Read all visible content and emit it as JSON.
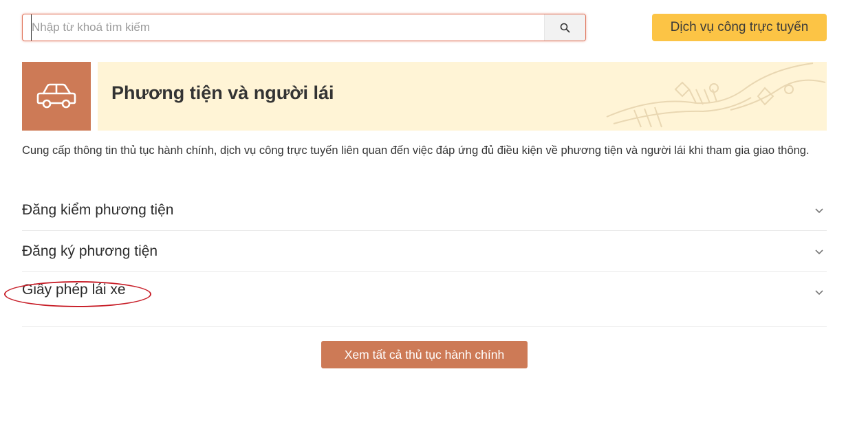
{
  "search": {
    "placeholder": "Nhập từ khoá tìm kiếm",
    "value": "",
    "button_icon": "search-icon"
  },
  "header": {
    "online_services_label": "Dịch vụ công trực tuyến"
  },
  "category": {
    "icon": "car-icon",
    "title": "Phương tiện và người lái",
    "description": "Cung cấp thông tin thủ tục hành chính, dịch vụ công trực tuyến liên quan đến việc đáp ứng đủ điều kiện về phương tiện và người lái khi tham gia giao thông."
  },
  "accordion": {
    "items": [
      {
        "label": "Đăng kiểm phương tiện",
        "icon": "chevron-down-icon"
      },
      {
        "label": "Đăng ký phương tiện",
        "icon": "chevron-down-icon"
      },
      {
        "label": "Giấy phép lái xe",
        "icon": "chevron-down-icon",
        "highlighted": true
      }
    ]
  },
  "footer": {
    "view_all_label": "Xem tất cả thủ tục hành chính"
  },
  "colors": {
    "accent": "#cd7a56",
    "online_button": "#fcc445",
    "banner_bg": "#fff4d6",
    "highlight_circle": "#c8202a"
  }
}
